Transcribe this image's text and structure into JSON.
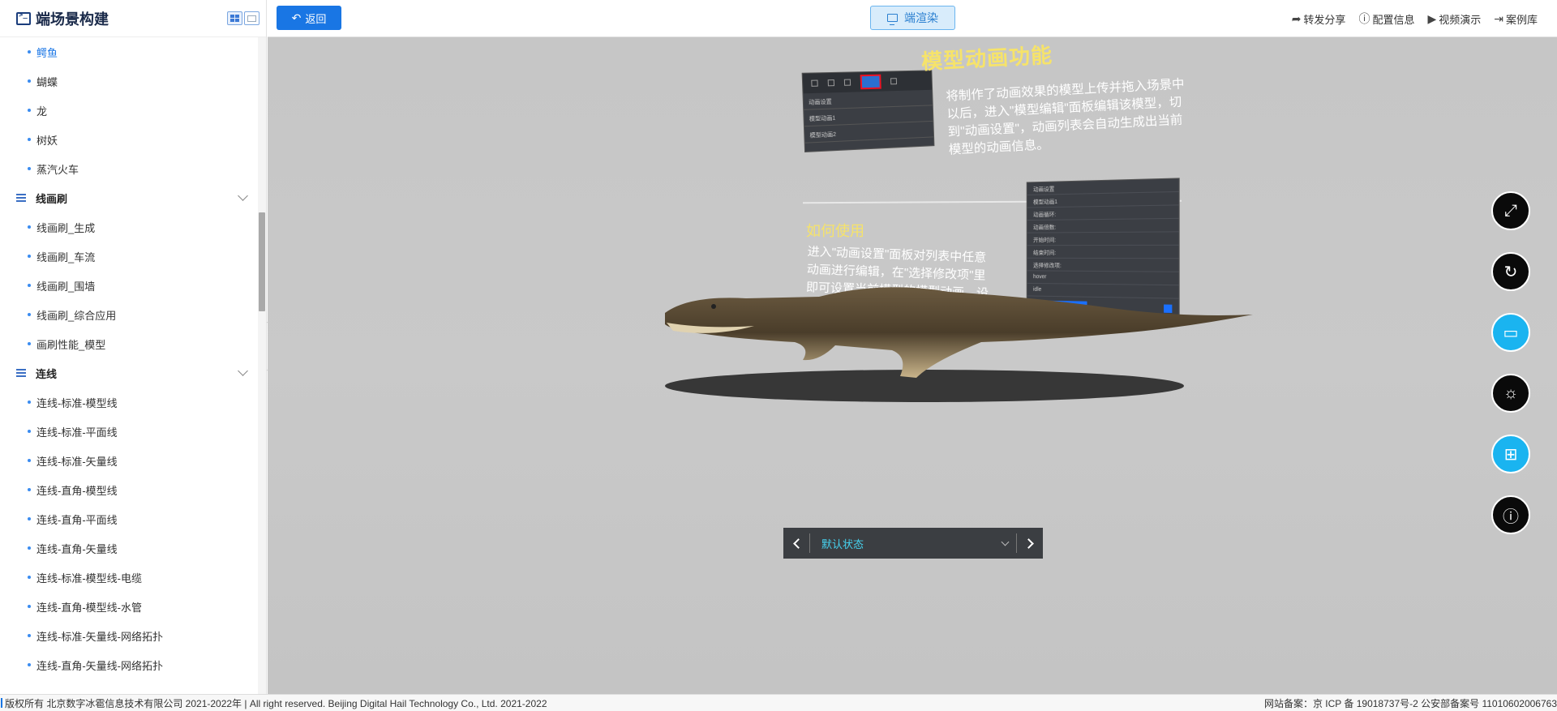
{
  "sidebar": {
    "title": "端场景构建",
    "items": [
      {
        "type": "item",
        "label": "鳄鱼",
        "active": true
      },
      {
        "type": "item",
        "label": "蝴蝶"
      },
      {
        "type": "item",
        "label": "龙"
      },
      {
        "type": "item",
        "label": "树妖"
      },
      {
        "type": "item",
        "label": "蒸汽火车"
      },
      {
        "type": "group",
        "label": "线画刷"
      },
      {
        "type": "item",
        "label": "线画刷_生成"
      },
      {
        "type": "item",
        "label": "线画刷_车流"
      },
      {
        "type": "item",
        "label": "线画刷_围墙"
      },
      {
        "type": "item",
        "label": "线画刷_综合应用"
      },
      {
        "type": "item",
        "label": "画刷性能_模型"
      },
      {
        "type": "group",
        "label": "连线"
      },
      {
        "type": "item",
        "label": "连线-标准-模型线"
      },
      {
        "type": "item",
        "label": "连线-标准-平面线"
      },
      {
        "type": "item",
        "label": "连线-标准-矢量线"
      },
      {
        "type": "item",
        "label": "连线-直角-模型线"
      },
      {
        "type": "item",
        "label": "连线-直角-平面线"
      },
      {
        "type": "item",
        "label": "连线-直角-矢量线"
      },
      {
        "type": "item",
        "label": "连线-标准-模型线-电缆"
      },
      {
        "type": "item",
        "label": "连线-直角-模型线-水管"
      },
      {
        "type": "item",
        "label": "连线-标准-矢量线-网络拓扑"
      },
      {
        "type": "item",
        "label": "连线-直角-矢量线-网络拓扑"
      }
    ]
  },
  "topbar": {
    "back_label": "返回",
    "render_label": "端渲染",
    "links": [
      {
        "icon": "share-icon",
        "glyph": "➦",
        "label": "转发分享"
      },
      {
        "icon": "info-icon",
        "glyph": "ⓘ",
        "label": "配置信息"
      },
      {
        "icon": "play-icon",
        "glyph": "▶",
        "label": "视频演示"
      },
      {
        "icon": "exit-icon",
        "glyph": "⇥",
        "label": "案例库"
      }
    ]
  },
  "viewport": {
    "title": "模型动画功能",
    "desc1": "将制作了动画效果的模型上传并拖入场景中以后，进入\"模型编辑\"面板编辑该模型，切到\"动画设置\"，动画列表会自动生成出当前模型的动画信息。",
    "subtitle": "如何使用",
    "desc2": "进入\"动画设置\"面板对列表中任意动画进行编辑，在\"选择修改项\"里即可设置当前模型的模型动画，设置好以后点击播放当前动画即可查看模型动画效果。",
    "panel1_rows": [
      "动画设置",
      "模型动画1",
      "模型动画2"
    ],
    "panel2_rows": [
      "动画设置",
      "模型动画1",
      "动画循环:",
      "动画倍数:",
      "开始时间:",
      "结束时间:",
      "选择修改项:",
      "hover",
      "idle"
    ],
    "state_label": "默认状态"
  },
  "side_tools": [
    {
      "name": "fullscreen-icon",
      "glyph": "⤢"
    },
    {
      "name": "rotate-icon",
      "glyph": "↻"
    },
    {
      "name": "video-icon",
      "glyph": "▭"
    },
    {
      "name": "weather-icon",
      "glyph": "☼"
    },
    {
      "name": "grid-icon",
      "glyph": "⊞"
    },
    {
      "name": "info-icon",
      "glyph": "ⓘ"
    }
  ],
  "footer": {
    "left": "版权所有 北京数字冰雹信息技术有限公司 2021-2022年 | All right reserved. Beijing Digital Hail Technology Co., Ltd. 2021-2022",
    "right": "网站备案：京 ICP 备 19018737号-2 公安部备案号 11010602006763"
  },
  "colors": {
    "accent": "#1976e4",
    "highlight": "#46d3f0",
    "title_yellow": "#f6e36a"
  }
}
